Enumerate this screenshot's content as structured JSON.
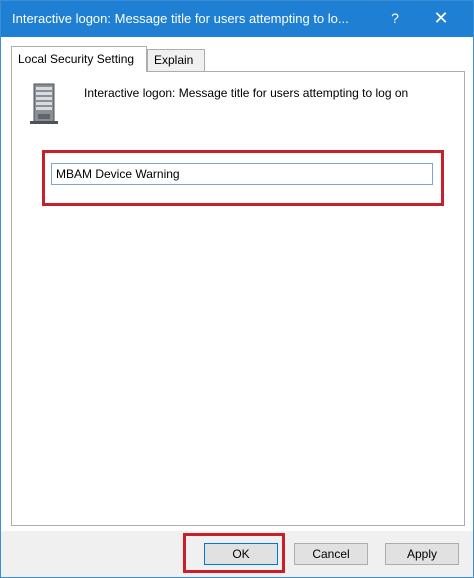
{
  "window": {
    "title": "Interactive logon: Message title for users attempting to lo...",
    "help_label": "?",
    "close_label": "✕"
  },
  "tabs": [
    {
      "label": "Local Security Setting",
      "active": true
    },
    {
      "label": "Explain",
      "active": false
    }
  ],
  "panel": {
    "icon": "server-icon",
    "policy_title": "Interactive logon: Message title for users attempting to log on",
    "input_value": "MBAM Device Warning"
  },
  "buttons": {
    "ok_label": "OK",
    "cancel_label": "Cancel",
    "apply_label": "Apply"
  },
  "colors": {
    "titlebar": "#1f7fd3",
    "highlight": "#c8202b"
  }
}
